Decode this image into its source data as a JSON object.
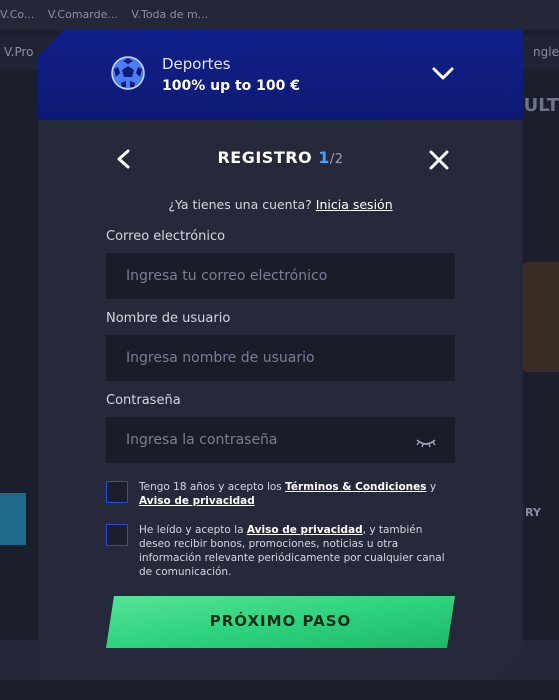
{
  "background": {
    "crumbs": [
      "V.Co...",
      "V.Comarde...",
      "V.Toda de m..."
    ],
    "left_tab": "V.Pro",
    "right_tab": "ngle",
    "sult": "SULT",
    "ry": "RY"
  },
  "promo": {
    "sport": "Deportes",
    "bonus": "100% up to 100 €",
    "icon": "soccer-ball-icon",
    "chevron_icon": "chevron-down-icon"
  },
  "header": {
    "title": "REGISTRO",
    "step": "1",
    "total": "/2",
    "back_icon": "chevron-left-icon",
    "close_icon": "close-icon"
  },
  "account": {
    "question": "¿Ya tienes una cuenta?",
    "login_link": "Inicia sesión"
  },
  "form": {
    "email_label": "Correo electrónico",
    "email_placeholder": "Ingresa tu correo electrónico",
    "email_value": "",
    "username_label": "Nombre de usuario",
    "username_placeholder": "Ingresa nombre de usuario",
    "username_value": "",
    "password_label": "Contraseña",
    "password_placeholder": "Ingresa la contraseña",
    "password_value": ""
  },
  "consent": {
    "age_text_1": "Tengo 18 años y acepto los",
    "terms_link": "Términos & Condiciones",
    "and": "y",
    "privacy_link": "Aviso de privacidad",
    "age_checked": false,
    "marketing_text_1": "He leído y acepto la",
    "marketing_privacy_link": "Aviso de privacidad",
    "marketing_text_2": ", y también deseo recibir bonos, promociones, noticias u otra información relevante periódicamente por cualquier canal de comunicación.",
    "marketing_checked": false
  },
  "next_button": {
    "label": "PRÓXIMO PASO"
  },
  "colors": {
    "accent_blue": "#3fa3ff",
    "promo_bg": "#11208a",
    "button_green": "#2fd37d",
    "checkbox_border": "#2d49d9"
  }
}
